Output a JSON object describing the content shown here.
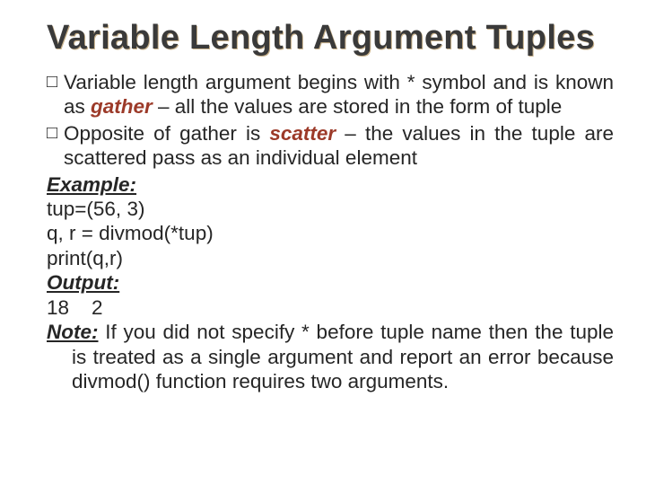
{
  "title": "Variable Length Argument Tuples",
  "bullet1": {
    "pre": "Variable length argument begins with * symbol and is known as ",
    "term": "gather",
    "post": " – all the values are stored in the form of tuple"
  },
  "bullet2": {
    "pre": "Opposite of gather is ",
    "term": "scatter",
    "post": " – the values in the tuple are scattered pass as an individual element"
  },
  "example_label": "Example:",
  "code_line1": "tup=(56, 3)",
  "code_line2": "q, r = divmod(*tup)",
  "code_line3": "print(q,r)",
  "output_label": "Output:",
  "output_value": "18    2",
  "note_label": "Note:",
  "note_text": " If you did not specify * before tuple name then the tuple is treated as a single argument and report an error because divmod() function requires two arguments."
}
